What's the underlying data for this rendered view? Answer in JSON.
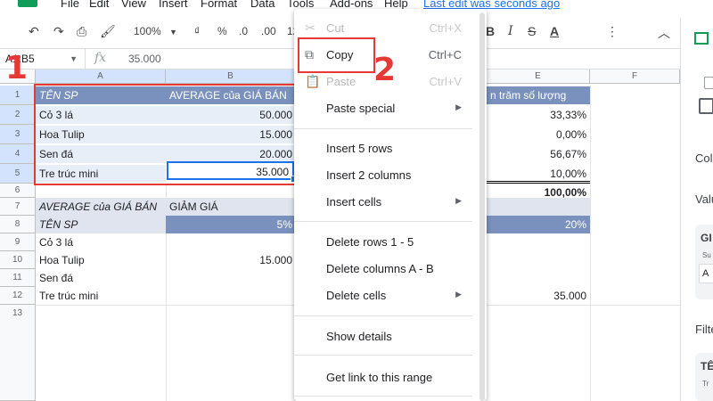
{
  "menubar": {
    "items": [
      "File",
      "Edit",
      "View",
      "Insert",
      "Format",
      "Data",
      "Tools",
      "Add-ons",
      "Help"
    ],
    "last_edit": "Last edit was seconds ago"
  },
  "toolbar": {
    "zoom": "100%",
    "currency": "₫",
    "percent": "%",
    "decimal_less": ".0",
    "decimal_more": ".00",
    "format_more": "12"
  },
  "formula_bar": {
    "name_box": "A1:B5",
    "fx": "fx",
    "value": "35.000"
  },
  "columns": [
    "A",
    "B",
    "C",
    "D",
    "E",
    "F"
  ],
  "rows": [
    "1",
    "2",
    "3",
    "4",
    "5",
    "6",
    "7",
    "8",
    "9",
    "10",
    "11",
    "12",
    "13"
  ],
  "sheet": {
    "a1": "TÊN SP",
    "b1": "AVERAGE của GIÁ BÁN",
    "e1": "n trăm số lượng",
    "a2": "Cỏ 3 lá",
    "b2": "50.000",
    "e2": "33,33%",
    "a3": "Hoa Tulip",
    "b3": "15.000",
    "e3": "0,00%",
    "a4": "Sen đá",
    "b4": "20.000",
    "e4": "56,67%",
    "a5": "Tre trúc mini",
    "b5": "35.000",
    "e5": "10,00%",
    "e6": "100,00%",
    "a7": "AVERAGE của GIÁ BÁN",
    "b7": "GIẢM GIÁ",
    "a8": "TÊN SP",
    "b8": "5%",
    "e8": "20%",
    "a9": "Cỏ 3 lá",
    "a10": "Hoa Tulip",
    "b10": "15.000",
    "a11": "Sen đá",
    "a12": "Tre trúc mini",
    "e12": "35.000"
  },
  "context_menu": {
    "cut": "Cut",
    "cut_sc": "Ctrl+X",
    "copy": "Copy",
    "copy_sc": "Ctrl+C",
    "paste": "Paste",
    "paste_sc": "Ctrl+V",
    "paste_special": "Paste special",
    "insert_rows": "Insert 5 rows",
    "insert_cols": "Insert 2 columns",
    "insert_cells": "Insert cells",
    "delete_rows": "Delete rows 1 - 5",
    "delete_cols": "Delete columns A - B",
    "delete_cells": "Delete cells",
    "show_details": "Show details",
    "get_link": "Get link to this range"
  },
  "annotations": {
    "step1": "1",
    "step2": "2"
  },
  "side_panel": {
    "col": "Col",
    "val": "Valu",
    "g": "GI",
    "su": "Su",
    "a": "A",
    "filt": "Filte",
    "te": "TÊ",
    "tr": "Tr"
  },
  "colors": {
    "accent": "#1a73e8",
    "pivot_header": "#7b91bd",
    "annotation_red": "#e53935",
    "selection_fill": "#e8eef8",
    "sheets_green": "#0f9d58"
  }
}
